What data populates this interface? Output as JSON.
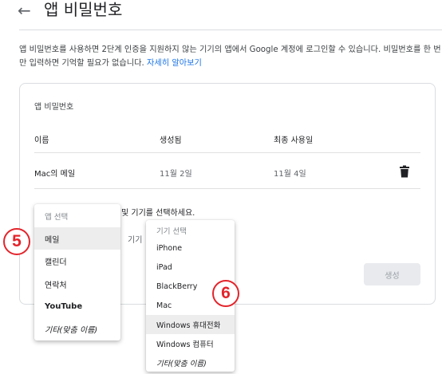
{
  "header": {
    "back_icon": "arrow-left-icon",
    "title": "앱 비밀번호"
  },
  "description": {
    "text": "앱 비밀번호를 사용하면 2단계 인증을 지원하지 않는 기기의 앱에서 Google 계정에 로그인할 수 있습니다. 비밀번호를 한 번만 입력하면 기억할 필요가 없습니다. ",
    "link": "자세히 알아보기",
    "link_color": "#1a73e8"
  },
  "card": {
    "title": "앱 비밀번호",
    "columns": [
      "이름",
      "생성됨",
      "최종 사용일"
    ],
    "rows": [
      {
        "name": "Mac의 메일",
        "created": "11월 2일",
        "last_used": "11월 4일",
        "delete_icon": "trash-icon"
      }
    ],
    "instruction_partial": "및 기기를 선택하세요.",
    "device_label_partial": "기기",
    "generate_button": "생성"
  },
  "app_menu": {
    "header": "앱 선택",
    "items": [
      "메일",
      "캘린더",
      "연락처",
      "YouTube",
      "기타(맞춤 이름)"
    ],
    "selected": "메일"
  },
  "device_menu": {
    "header": "기기 선택",
    "items": [
      "iPhone",
      "iPad",
      "BlackBerry",
      "Mac",
      "Windows 휴대전화",
      "Windows 컴퓨터",
      "기타(맞춤 이름)"
    ],
    "selected": "Windows 휴대전화"
  },
  "callouts": {
    "step_app": "5",
    "step_device": "6",
    "color": "#e3242b"
  }
}
